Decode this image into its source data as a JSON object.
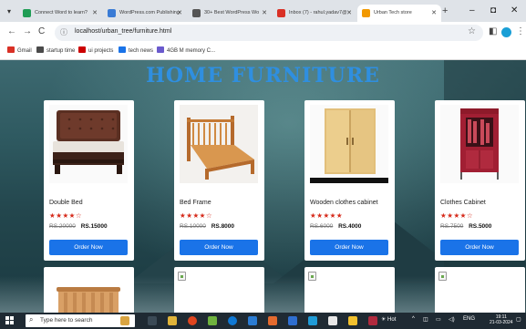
{
  "browser": {
    "tabs": [
      {
        "title": "Connect Word to learn?",
        "color": "#1f9d55",
        "active": false
      },
      {
        "title": "WordPress.com Publishing",
        "color": "#3a7bd5",
        "active": false
      },
      {
        "title": "30+ Best WordPress Wo",
        "color": "#555555",
        "active": false
      },
      {
        "title": "Inbox (7) - rahul.yadav7@",
        "color": "#d93025",
        "active": false
      },
      {
        "title": "Urban Tech store",
        "color": "#f29900",
        "active": true
      }
    ],
    "new_tab": "+",
    "window_controls": {
      "minimize": "–",
      "maximize": "◘",
      "close": "✕"
    },
    "nav": {
      "back": "←",
      "forward": "→",
      "reload": "C"
    },
    "url": "localhost/urban_tree/furniture.html",
    "bookmarks": [
      {
        "label": "Gmail",
        "color": "#d93025"
      },
      {
        "label": "startup time",
        "color": "#4a4a4a"
      },
      {
        "label": "ui projects",
        "color": "#cc0000"
      },
      {
        "label": "tech news",
        "color": "#1a73e8"
      },
      {
        "label": "4GB M memory C...",
        "color": "#6a5acd"
      }
    ]
  },
  "page": {
    "title": "HOME FURNITURE",
    "products": [
      {
        "name": "Double Bed",
        "rating": "★★★★☆",
        "old_price": "RS.20000",
        "price": "RS.15000",
        "button": "Order Now",
        "image": "bed"
      },
      {
        "name": "Bed Frame",
        "rating": "★★★★☆",
        "old_price": "RS.10000",
        "price": "RS.8000",
        "button": "Order Now",
        "image": "bed-frame"
      },
      {
        "name": "Wooden clothes cabinet",
        "rating": "★★★★★",
        "old_price": "RS.6000",
        "price": "RS.4000",
        "button": "Order Now",
        "image": "wardrobe"
      },
      {
        "name": "Clothes Cabinet",
        "rating": "★★★★☆",
        "old_price": "RS.7500",
        "price": "RS.5000",
        "button": "Order Now",
        "image": "cloth-rack"
      }
    ]
  },
  "taskbar": {
    "search_placeholder": "Type here to search",
    "weather": "Hot",
    "language": "ENG",
    "time": "19:11",
    "date": "21-03-2024"
  }
}
